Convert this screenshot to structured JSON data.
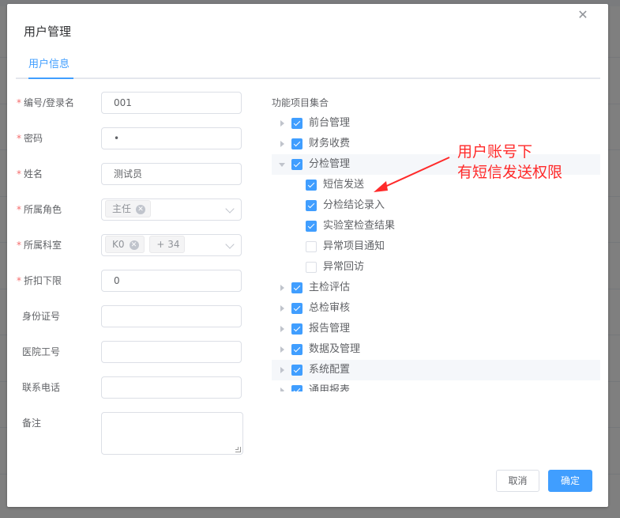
{
  "dialog": {
    "title": "用户管理",
    "close_icon": "close-icon"
  },
  "tabs": [
    {
      "label": "用户信息",
      "active": true
    }
  ],
  "form": {
    "login": {
      "label": "编号/登录名",
      "required": true,
      "value": "001"
    },
    "password": {
      "label": "密码",
      "required": true,
      "value": "•"
    },
    "name": {
      "label": "姓名",
      "required": true,
      "value": "测试员"
    },
    "role": {
      "label": "所属角色",
      "required": true,
      "tags": [
        "主任"
      ]
    },
    "dept": {
      "label": "所属科室",
      "required": true,
      "tags": [
        "K0"
      ],
      "more": "+ 34"
    },
    "discount": {
      "label": "折扣下限",
      "required": true,
      "value": "0"
    },
    "idcard": {
      "label": "身份证号",
      "required": false,
      "value": ""
    },
    "hospital_no": {
      "label": "医院工号",
      "required": false,
      "value": ""
    },
    "phone": {
      "label": "联系电话",
      "required": false,
      "value": ""
    },
    "remark": {
      "label": "备注",
      "required": false,
      "value": ""
    }
  },
  "tree": {
    "title": "功能项目集合",
    "nodes": [
      {
        "label": "前台管理",
        "checked": true,
        "level": 0,
        "expanded": false
      },
      {
        "label": "财务收费",
        "checked": true,
        "level": 0,
        "expanded": false
      },
      {
        "label": "分检管理",
        "checked": true,
        "level": 0,
        "expanded": true
      },
      {
        "label": "短信发送",
        "checked": true,
        "level": 1
      },
      {
        "label": "分检结论录入",
        "checked": true,
        "level": 1
      },
      {
        "label": "实验室检查结果",
        "checked": true,
        "level": 1
      },
      {
        "label": "异常项目通知",
        "checked": false,
        "level": 1
      },
      {
        "label": "异常回访",
        "checked": false,
        "level": 1
      },
      {
        "label": "主检评估",
        "checked": true,
        "level": 0,
        "expanded": false
      },
      {
        "label": "总检审核",
        "checked": true,
        "level": 0,
        "expanded": false
      },
      {
        "label": "报告管理",
        "checked": true,
        "level": 0,
        "expanded": false
      },
      {
        "label": "数据及管理",
        "checked": true,
        "level": 0,
        "expanded": false
      },
      {
        "label": "系统配置",
        "checked": true,
        "level": 0,
        "expanded": false
      },
      {
        "label": "通用报表",
        "checked": true,
        "level": 0,
        "expanded": false
      }
    ]
  },
  "annotation": {
    "line1": "用户账号下",
    "line2": "有短信发送权限",
    "color": "#ff2a2a"
  },
  "footer": {
    "cancel_label": "取消",
    "ok_label": "确定"
  },
  "colors": {
    "primary": "#409eff",
    "required": "#f56c6c"
  }
}
